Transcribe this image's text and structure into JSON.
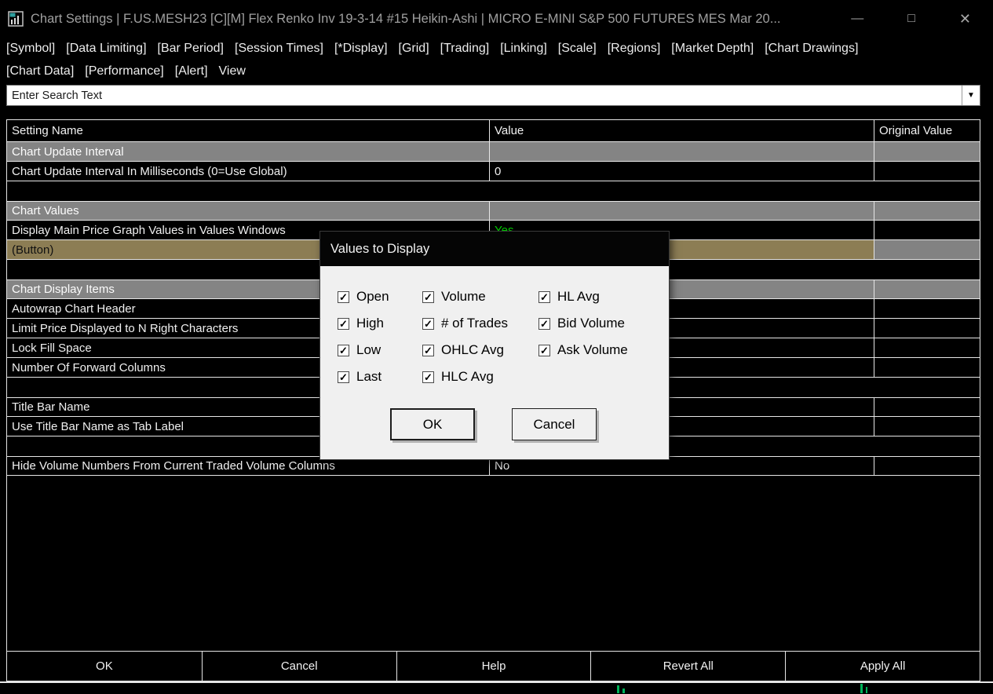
{
  "window": {
    "title": "Chart Settings | F.US.MESH23 [C][M]  Flex Renko Inv 19-3-14  #15 Heikin-Ashi | MICRO E-MINI S&P 500 FUTURES MES Mar 20...",
    "controls": {
      "minimize": "—",
      "maximize": "□",
      "close": "✕"
    }
  },
  "menu": {
    "row1": [
      "[Symbol]",
      "[Data Limiting]",
      "[Bar Period]",
      "[Session Times]",
      "[*Display]",
      "[Grid]",
      "[Trading]",
      "[Linking]",
      "[Scale]",
      "[Regions]",
      "[Market Depth]",
      "[Chart Drawings]"
    ],
    "row2": [
      "[Chart Data]",
      "[Performance]",
      "[Alert]",
      "View"
    ]
  },
  "search": {
    "value": "Enter Search Text"
  },
  "table": {
    "headers": [
      "Setting Name",
      "Value",
      "Original Value"
    ],
    "rows": [
      {
        "type": "section",
        "name": "Chart Update Interval",
        "value": "",
        "original": ""
      },
      {
        "type": "item",
        "name": "Chart Update Interval In Milliseconds (0=Use Global)",
        "value": "0",
        "original": ""
      },
      {
        "type": "empty",
        "name": "",
        "value": "",
        "original": ""
      },
      {
        "type": "section",
        "name": "Chart Values",
        "value": "",
        "original": ""
      },
      {
        "type": "item",
        "name": "Display Main Price Graph Values in Values Windows",
        "value": "Yes",
        "value_color": "green",
        "original": ""
      },
      {
        "type": "selected",
        "name": " (Button)",
        "value": "",
        "original": ""
      },
      {
        "type": "empty",
        "name": "",
        "value": "",
        "original": ""
      },
      {
        "type": "section",
        "name": "Chart Display Items",
        "value": "",
        "original": ""
      },
      {
        "type": "item",
        "name": "Autowrap Chart Header",
        "value": "",
        "original": ""
      },
      {
        "type": "item",
        "name": "Limit Price Displayed to N Right Characters",
        "value": "",
        "original": ""
      },
      {
        "type": "item",
        "name": "Lock Fill Space",
        "value": "",
        "original": ""
      },
      {
        "type": "item",
        "name": "Number Of Forward Columns",
        "value": "",
        "original": ""
      },
      {
        "type": "empty",
        "name": "",
        "value": "",
        "original": ""
      },
      {
        "type": "item",
        "name": "Title Bar Name",
        "value": "",
        "original": ""
      },
      {
        "type": "item",
        "name": "Use Title Bar Name as Tab Label",
        "value": "",
        "original": ""
      },
      {
        "type": "empty",
        "name": "",
        "value": "",
        "original": ""
      },
      {
        "type": "item",
        "name": "Hide Volume Numbers From Current Traded Volume Columns",
        "value": "No",
        "original": ""
      }
    ]
  },
  "dialog": {
    "title": "Values to Display",
    "columns": [
      [
        {
          "label": "Open",
          "checked": true
        },
        {
          "label": "High",
          "checked": true
        },
        {
          "label": "Low",
          "checked": true
        },
        {
          "label": "Last",
          "checked": true
        }
      ],
      [
        {
          "label": "Volume",
          "checked": true
        },
        {
          "label": "# of Trades",
          "checked": true
        },
        {
          "label": "OHLC Avg",
          "checked": true
        },
        {
          "label": "HLC Avg",
          "checked": true
        }
      ],
      [
        {
          "label": "HL Avg",
          "checked": true
        },
        {
          "label": "Bid Volume",
          "checked": true
        },
        {
          "label": "Ask Volume",
          "checked": true
        }
      ]
    ],
    "buttons": {
      "ok": "OK",
      "cancel": "Cancel"
    }
  },
  "footer": {
    "buttons": [
      "OK",
      "Cancel",
      "Help",
      "Revert All",
      "Apply All"
    ]
  },
  "colors": {
    "value_green": "#00d400",
    "section_gray": "#848484",
    "selected_tan": "#8c7d54"
  }
}
